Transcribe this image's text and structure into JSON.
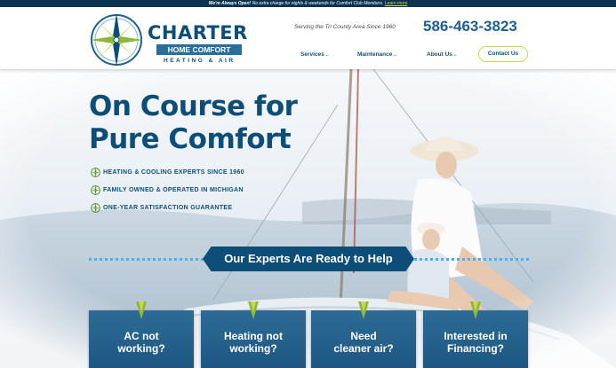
{
  "topbar": {
    "lead": "We're Always Open!",
    "text": "No extra charge for nights & weekends for Comfort Club Members.",
    "link": "Learn more"
  },
  "logo": {
    "name": "CHARTER",
    "subname": "HOME COMFORT",
    "tagline": "HEATING & AIR"
  },
  "header": {
    "service_area": "Serving the Tri County Area Since 1960",
    "phone": "586-463-3823"
  },
  "nav": {
    "items": [
      {
        "label": "Services",
        "caret": "⌄"
      },
      {
        "label": "Maintenance",
        "caret": "⌄"
      },
      {
        "label": "About Us",
        "caret": "⌄"
      }
    ],
    "contact": "Contact Us"
  },
  "hero": {
    "title_line1": "On Course for",
    "title_line2": "Pure Comfort",
    "features": [
      "HEATING & COOLING EXPERTS SINCE 1960",
      "FAMILY OWNED & OPERATED IN MICHIGAN",
      "ONE-YEAR SATISFACTION GUARANTEE"
    ],
    "banner": "Our Experts Are Ready to Help"
  },
  "cards": [
    {
      "text": "AC not\nworking?"
    },
    {
      "text": "Heating not\nworking?"
    },
    {
      "text": "Need\ncleaner air?"
    },
    {
      "text": "Interested in\nFinancing?"
    }
  ],
  "colors": {
    "brand_navy": "#0d4e79",
    "accent_green": "#c9d94c",
    "topbar_bg": "#0b3350",
    "banner_bg": "#0d4e79"
  }
}
